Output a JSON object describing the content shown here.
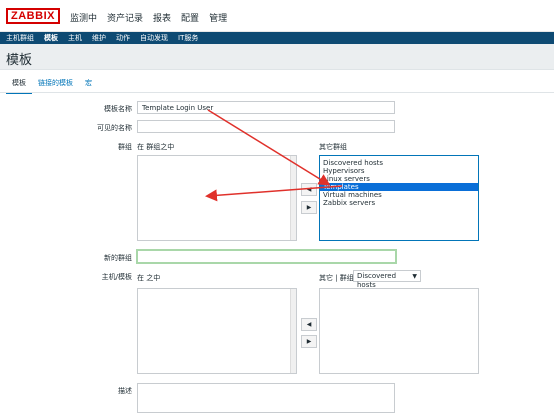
{
  "app": {
    "logo": "ZABBIX"
  },
  "topmenu": [
    "监测中",
    "资产记录",
    "报表",
    "配置",
    "管理"
  ],
  "submenu": [
    "主机群组",
    "模板",
    "主机",
    "维护",
    "动作",
    "自动发现",
    "IT服务"
  ],
  "page": {
    "title": "模板"
  },
  "tabs": [
    "模板",
    "链接的模板",
    "宏"
  ],
  "form": {
    "template_name_label": "模板名称",
    "template_name_value": "Template Login User",
    "visible_name_label": "可见的名称",
    "visible_name_value": "",
    "groups_label": "群组",
    "in_groups_label": "在 群组之中",
    "other_groups_label": "其它群组",
    "other_groups": [
      "Discovered hosts",
      "Hypervisors",
      "Linux servers",
      "Templates",
      "Virtual machines",
      "Zabbix servers"
    ],
    "selected_group": "Templates",
    "new_group_label": "新的群组",
    "hosts_label": "主机/模板",
    "in_hosts_label": "在 之中",
    "other_group_filter_label": "其它 | 群组",
    "other_group_filter_value": "Discovered hosts",
    "description_label": "描述",
    "move_left": "◀",
    "move_right": "▶"
  },
  "colors": {
    "brand": "#d40000",
    "nav": "#0e4a73",
    "selected": "#0a6fd8",
    "annotation_arrow": "#e0312b"
  }
}
